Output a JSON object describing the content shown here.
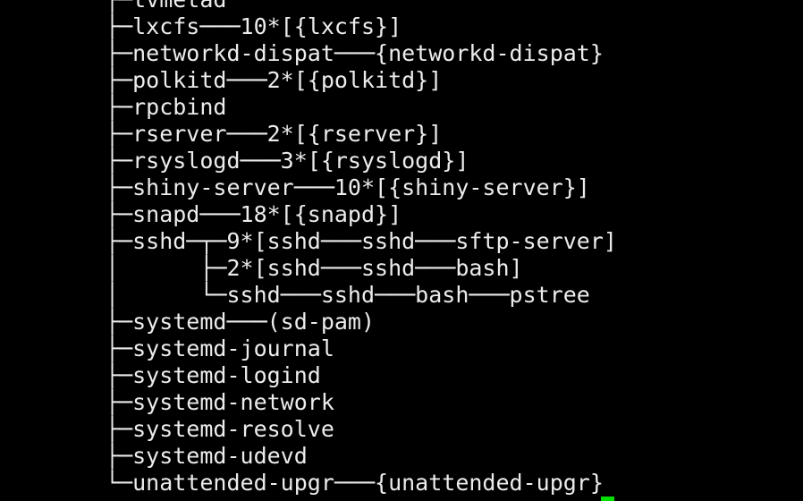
{
  "terminal": {
    "lines": [
      "├─tvmetad",
      "├─lxcfs───10*[{lxcfs}]",
      "├─networkd-dispat───{networkd-dispat}",
      "├─polkitd───2*[{polkitd}]",
      "├─rpcbind",
      "├─rserver───2*[{rserver}]",
      "├─rsyslogd───3*[{rsyslogd}]",
      "├─shiny-server───10*[{shiny-server}]",
      "├─snapd───18*[{snapd}]",
      "├─sshd─┬─9*[sshd───sshd───sftp-server]",
      "│      ├─2*[sshd───sshd───bash]",
      "│      └─sshd───sshd───bash───pstree",
      "├─systemd───(sd-pam)",
      "├─systemd-journal",
      "├─systemd-logind",
      "├─systemd-network",
      "├─systemd-resolve",
      "├─systemd-udevd",
      "└─unattended-upgr───{unattended-upgr}"
    ],
    "colors": {
      "background": "#000000",
      "text": "#ececec",
      "cursor": "#00e000"
    }
  }
}
